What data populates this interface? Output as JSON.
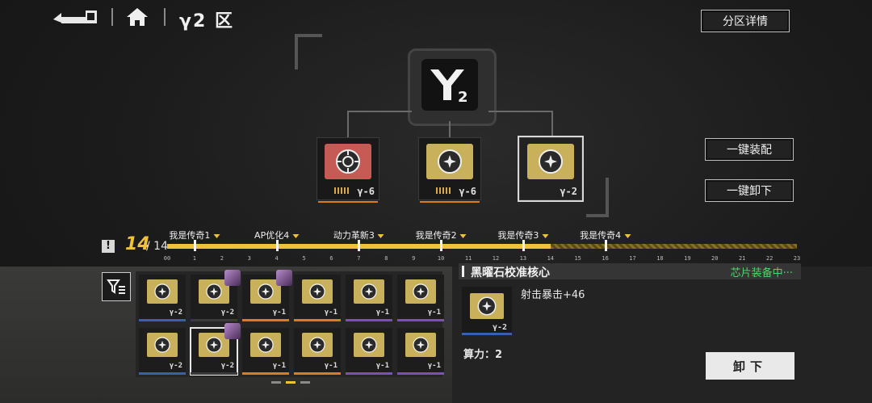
{
  "header": {
    "zone_title": "γ2 区",
    "detail_button": "分区详情"
  },
  "core": {
    "logo": "γ2"
  },
  "colors": {
    "accent": "#f0c23a",
    "equipped": "#4fd36b",
    "red_chip": "#c65a55",
    "gold_chip": "#c9b05a"
  },
  "equipped_chips": [
    {
      "name": "red-gamma6-chip",
      "label": "γ-6"
    },
    {
      "name": "gold-gamma6-chip",
      "label": "γ-6"
    },
    {
      "name": "gold-gamma2-chip",
      "label": "γ-2"
    }
  ],
  "actions": {
    "equip_all": "一键装配",
    "unequip_all": "一键卸下"
  },
  "progress": {
    "current": "14",
    "total": "/ 14",
    "milestones": [
      {
        "label": "我是传奇1",
        "pos": 1
      },
      {
        "label": "AP优化4",
        "pos": 4
      },
      {
        "label": "动力革新3",
        "pos": 7
      },
      {
        "label": "我是传奇2",
        "pos": 10
      },
      {
        "label": "我是传奇3",
        "pos": 13
      },
      {
        "label": "我是传奇4",
        "pos": 16
      }
    ],
    "ticks": [
      "00",
      "1",
      "2",
      "3",
      "4",
      "5",
      "6",
      "7",
      "8",
      "9",
      "10",
      "11",
      "12",
      "13",
      "14",
      "15",
      "16",
      "17",
      "18",
      "19",
      "20",
      "21",
      "22",
      "23"
    ],
    "filled_to": 14,
    "max": 23
  },
  "inventory": {
    "row1": [
      {
        "label": "γ-2",
        "bar": "#3a5fb0"
      },
      {
        "label": "γ-2",
        "bar": "#3a3a3a",
        "avatar": true
      },
      {
        "label": "γ-1",
        "bar": "#e07b1a",
        "avatar": true
      },
      {
        "label": "γ-1",
        "bar": "#e07b1a"
      },
      {
        "label": "γ-1",
        "bar": "#7a4fc0"
      },
      {
        "label": "γ-1",
        "bar": "#7a4fc0"
      }
    ],
    "row2": [
      {
        "label": "γ-2",
        "bar": "#3a5fb0"
      },
      {
        "label": "γ-2",
        "bar": "#3a3a3a",
        "avatar": true,
        "selected": true
      },
      {
        "label": "γ-1",
        "bar": "#e07b1a"
      },
      {
        "label": "γ-1",
        "bar": "#e07b1a"
      },
      {
        "label": "γ-1",
        "bar": "#7a4fc0"
      },
      {
        "label": "γ-1",
        "bar": "#7a4fc0"
      }
    ]
  },
  "detail": {
    "title": "黑曜石校准核心",
    "status": "芯片装备中···",
    "stat": "射击暴击+46",
    "chip_label": "γ-2",
    "power": "算力：2",
    "unload_button": "卸下"
  }
}
